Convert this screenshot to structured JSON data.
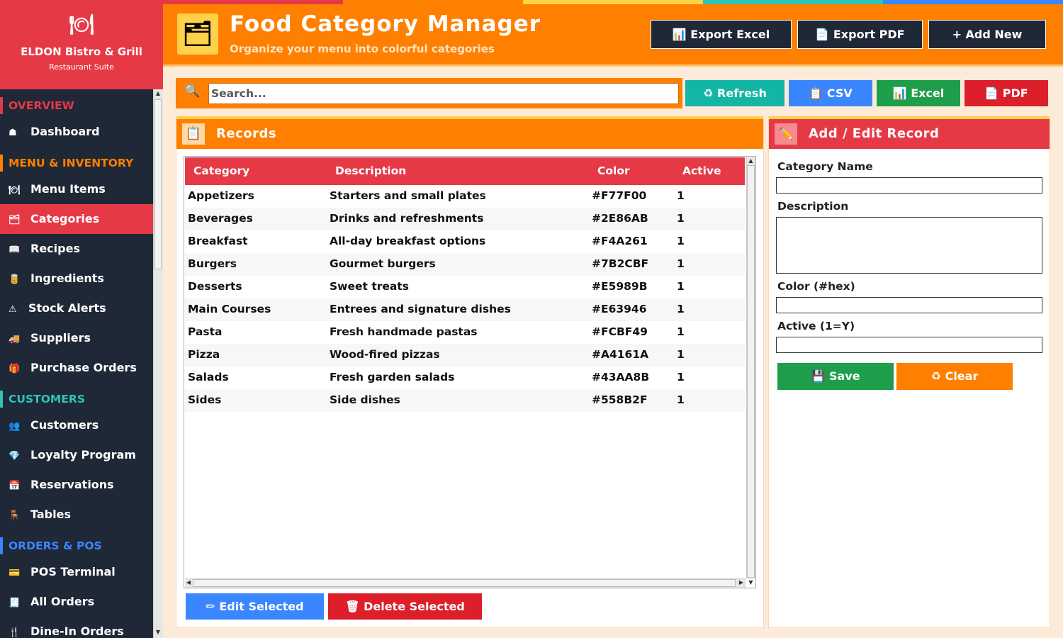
{
  "brand": {
    "logo_icon": "🍽",
    "name": "ELDON Bistro & Grill",
    "subtitle": "Restaurant Suite"
  },
  "sidebar": {
    "sections": [
      {
        "label": "OVERVIEW",
        "color": "#E63946"
      },
      {
        "label": "MENU & INVENTORY",
        "color": "#FF7F00"
      },
      {
        "label": "CUSTOMERS",
        "color": "#2EC4B6"
      },
      {
        "label": "ORDERS & POS",
        "color": "#3A86FF"
      }
    ],
    "items": [
      {
        "icon": "☗",
        "label": "Dashboard"
      },
      {
        "icon": "🍽",
        "label": "Menu Items"
      },
      {
        "icon": "🗂",
        "label": "Categories"
      },
      {
        "icon": "📖",
        "label": "Recipes"
      },
      {
        "icon": "🥫",
        "label": "Ingredients"
      },
      {
        "icon": "⚠",
        "label": "Stock Alerts"
      },
      {
        "icon": "🚚",
        "label": "Suppliers"
      },
      {
        "icon": "🎁",
        "label": "Purchase Orders"
      },
      {
        "icon": "👥",
        "label": "Customers"
      },
      {
        "icon": "💎",
        "label": "Loyalty Program"
      },
      {
        "icon": "📅",
        "label": "Reservations"
      },
      {
        "icon": "🪑",
        "label": "Tables"
      },
      {
        "icon": "💳",
        "label": "POS Terminal"
      },
      {
        "icon": "🧾",
        "label": "All Orders"
      },
      {
        "icon": "🍴",
        "label": "Dine-In Orders"
      }
    ],
    "active_item": "Categories"
  },
  "header": {
    "icon": "🗂",
    "title": "Food Category Manager",
    "subtitle": "Organize your menu into colorful categories",
    "buttons": {
      "export_excel": "📊 Export Excel",
      "export_pdf": "📄 Export PDF",
      "add_new": "+ Add New"
    },
    "strip_colors": [
      "#E63946",
      "#FF7F00",
      "#FFD04A",
      "#2EC4B6",
      "#3A86FF"
    ]
  },
  "toolbar": {
    "search_icon": "🔍",
    "search_placeholder": "Search...",
    "refresh": "♻ Refresh",
    "csv": "📋 CSV",
    "excel": "📊 Excel",
    "pdf": "📄 PDF"
  },
  "records": {
    "icon": "📋",
    "title": "Records",
    "columns": [
      "Category",
      "Description",
      "Color",
      "Active"
    ],
    "rows": [
      [
        "Appetizers",
        "Starters and small plates",
        "#F77F00",
        "1"
      ],
      [
        "Beverages",
        "Drinks and refreshments",
        "#2E86AB",
        "1"
      ],
      [
        "Breakfast",
        "All-day breakfast options",
        "#F4A261",
        "1"
      ],
      [
        "Burgers",
        "Gourmet burgers",
        "#7B2CBF",
        "1"
      ],
      [
        "Desserts",
        "Sweet treats",
        "#E5989B",
        "1"
      ],
      [
        "Main Courses",
        "Entrees and signature dishes",
        "#E63946",
        "1"
      ],
      [
        "Pasta",
        "Fresh handmade pastas",
        "#FCBF49",
        "1"
      ],
      [
        "Pizza",
        "Wood-fired pizzas",
        "#A4161A",
        "1"
      ],
      [
        "Salads",
        "Fresh garden salads",
        "#43AA8B",
        "1"
      ],
      [
        "Sides",
        "Side dishes",
        "#558B2F",
        "1"
      ]
    ],
    "edit_selected": "✏ Edit Selected",
    "delete_selected": "🗑 Delete Selected"
  },
  "form": {
    "icon": "✏️",
    "title": "Add / Edit Record",
    "fields": [
      {
        "label": "Category Name",
        "value": ""
      },
      {
        "label": "Description",
        "value": ""
      },
      {
        "label": "Color (#hex)",
        "value": ""
      },
      {
        "label": "Active (1=Y)",
        "value": ""
      }
    ],
    "save": "💾 Save",
    "clear": "♻ Clear"
  },
  "colors": {
    "sidebar_bg": "#1F2837",
    "brand_red": "#E63946",
    "orange": "#FF7F00",
    "teal": "#13B5A5",
    "blue": "#3A86FF",
    "green": "#1E9E4A",
    "red_button": "#DC1F2A",
    "page_bg": "#FCEBD8"
  }
}
